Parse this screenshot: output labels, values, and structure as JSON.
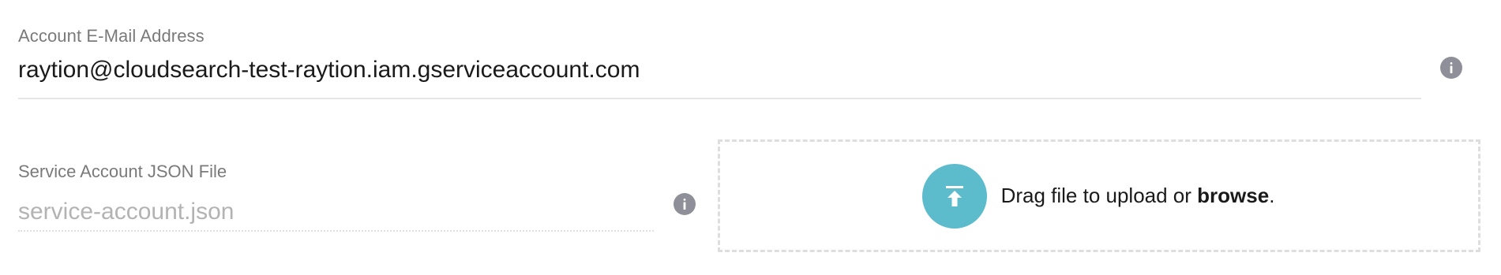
{
  "email": {
    "label": "Account E-Mail Address",
    "value": "raytion@cloudsearch-test-raytion.iam.gserviceaccount.com",
    "info_icon": "info-icon"
  },
  "service_account_file": {
    "label": "Service Account JSON File",
    "placeholder": "service-account.json",
    "info_icon": "info-icon"
  },
  "dropzone": {
    "icon": "upload-icon",
    "text_prefix": "Drag file to upload or ",
    "browse_label": "browse",
    "text_suffix": "."
  },
  "colors": {
    "accent": "#5cbccb",
    "info_icon": "#8f8f99",
    "label": "#7a7a7a",
    "placeholder": "#b3b3b3"
  }
}
